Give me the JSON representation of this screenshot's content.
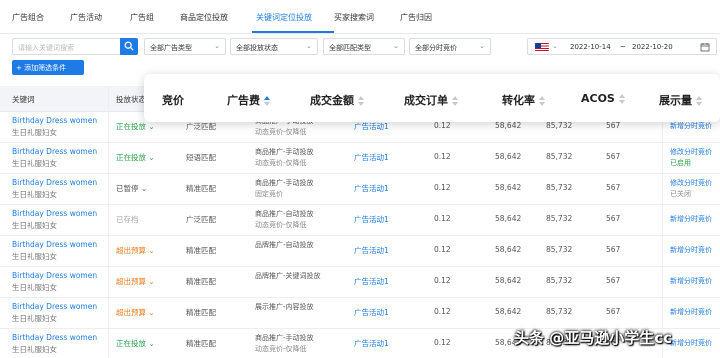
{
  "tabs": [
    "广告组合",
    "广告活动",
    "广告组",
    "商品定位投放",
    "关键词定位投放",
    "买家搜索词",
    "广告归因"
  ],
  "active_tab": "关键词定位投放",
  "filters": {
    "search_placeholder": "请输入关键词搜索",
    "ad_type": "全部广告类型",
    "placement_status": "全部投放状态",
    "match_type": "全部匹配类型",
    "time_bid": "全部分时竞价",
    "date_start": "2022-10-14",
    "date_sep": "~",
    "date_end": "2022-10-20",
    "country_flag": "us-flag-icon"
  },
  "add_filter_label": "+ 添加筛选条件",
  "table_headers": {
    "keyword": "关键词",
    "status": "投放状态"
  },
  "overlay_headers": [
    "竞价",
    "广告费",
    "成交金额",
    "成交订单",
    "转化率",
    "ACOS",
    "展示量"
  ],
  "sort_active": "广告费",
  "rows": [
    {
      "kw1": "Birthday Dress women",
      "kw2": "生日礼服妇女",
      "status": "正在投放",
      "status_color": "green",
      "match": "广泛匹配",
      "type1": "商品推广-手动投放",
      "type2": "动态竞价-仅降低",
      "group": "广告活动1",
      "bid": "0.12",
      "spend": "58,642",
      "sales": "85,732",
      "orders": "567",
      "r1": "新增分时竞价",
      "r2": ""
    },
    {
      "kw1": "Birthday Dress women",
      "kw2": "生日礼服妇女",
      "status": "正在投放",
      "status_color": "green",
      "match": "短语匹配",
      "type1": "商品推广-手动投放",
      "type2": "动态竞价-仅降低",
      "group": "广告活动1",
      "bid": "0.12",
      "spend": "58,642",
      "sales": "85,732",
      "orders": "567",
      "r1": "修改分时竞价",
      "r2": "已启用"
    },
    {
      "kw1": "Birthday Dress women",
      "kw2": "生日礼服妇女",
      "status": "已暂停",
      "status_color": "gray",
      "match": "精准匹配",
      "type1": "商品推广-手动投放",
      "type2": "固定竞价",
      "group": "广告活动1",
      "bid": "0.12",
      "spend": "58,642",
      "sales": "85,732",
      "orders": "567",
      "r1": "修改分时竞价",
      "r2": "已关闭"
    },
    {
      "kw1": "Birthday Dress women",
      "kw2": "生日礼服妇女",
      "status": "已存档",
      "status_color": "light",
      "match": "广泛匹配",
      "type1": "商品推广-自动投放",
      "type2": "动态竞价-仅降低",
      "group": "广告活动1",
      "bid": "0.12",
      "spend": "58,642",
      "sales": "85,732",
      "orders": "567",
      "r1": "新增分时竞价",
      "r2": ""
    },
    {
      "kw1": "Birthday Dress women",
      "kw2": "生日礼服妇女",
      "status": "超出预算",
      "status_color": "orange",
      "match": "精准匹配",
      "type1": "品牌推广-自动投放",
      "type2": "",
      "group": "广告活动1",
      "bid": "0.12",
      "spend": "58,642",
      "sales": "85,732",
      "orders": "567",
      "r1": "新增分时竞价",
      "r2": ""
    },
    {
      "kw1": "Birthday Dress women",
      "kw2": "生日礼服妇女",
      "status": "超出预算",
      "status_color": "orange",
      "match": "精准匹配",
      "type1": "品牌推广-关键词投放",
      "type2": "",
      "group": "广告活动1",
      "bid": "0.12",
      "spend": "58,642",
      "sales": "85,732",
      "orders": "567",
      "r1": "新增分时竞价",
      "r2": ""
    },
    {
      "kw1": "Birthday Dress women",
      "kw2": "生日礼服妇女",
      "status": "超出预算",
      "status_color": "orange",
      "match": "精准匹配",
      "type1": "展示推广-内容投放",
      "type2": "",
      "group": "广告活动1",
      "bid": "0.12",
      "spend": "58,642",
      "sales": "85,732",
      "orders": "567",
      "r1": "新增分时竞价",
      "r2": ""
    },
    {
      "kw1": "Birthday Dress women",
      "kw2": "生日礼服妇女",
      "status": "正在投放",
      "status_color": "green",
      "match": "精准匹配",
      "type1": "商品推广-手动投放",
      "type2": "动态竞价-仅降低",
      "group": "广告活动1",
      "bid": "0.12",
      "spend": "58,642",
      "sales": "85,732",
      "orders": "567",
      "r1": "新增分时竞价",
      "r2": ""
    }
  ],
  "watermark": "头条 @亚马逊小学生cc"
}
